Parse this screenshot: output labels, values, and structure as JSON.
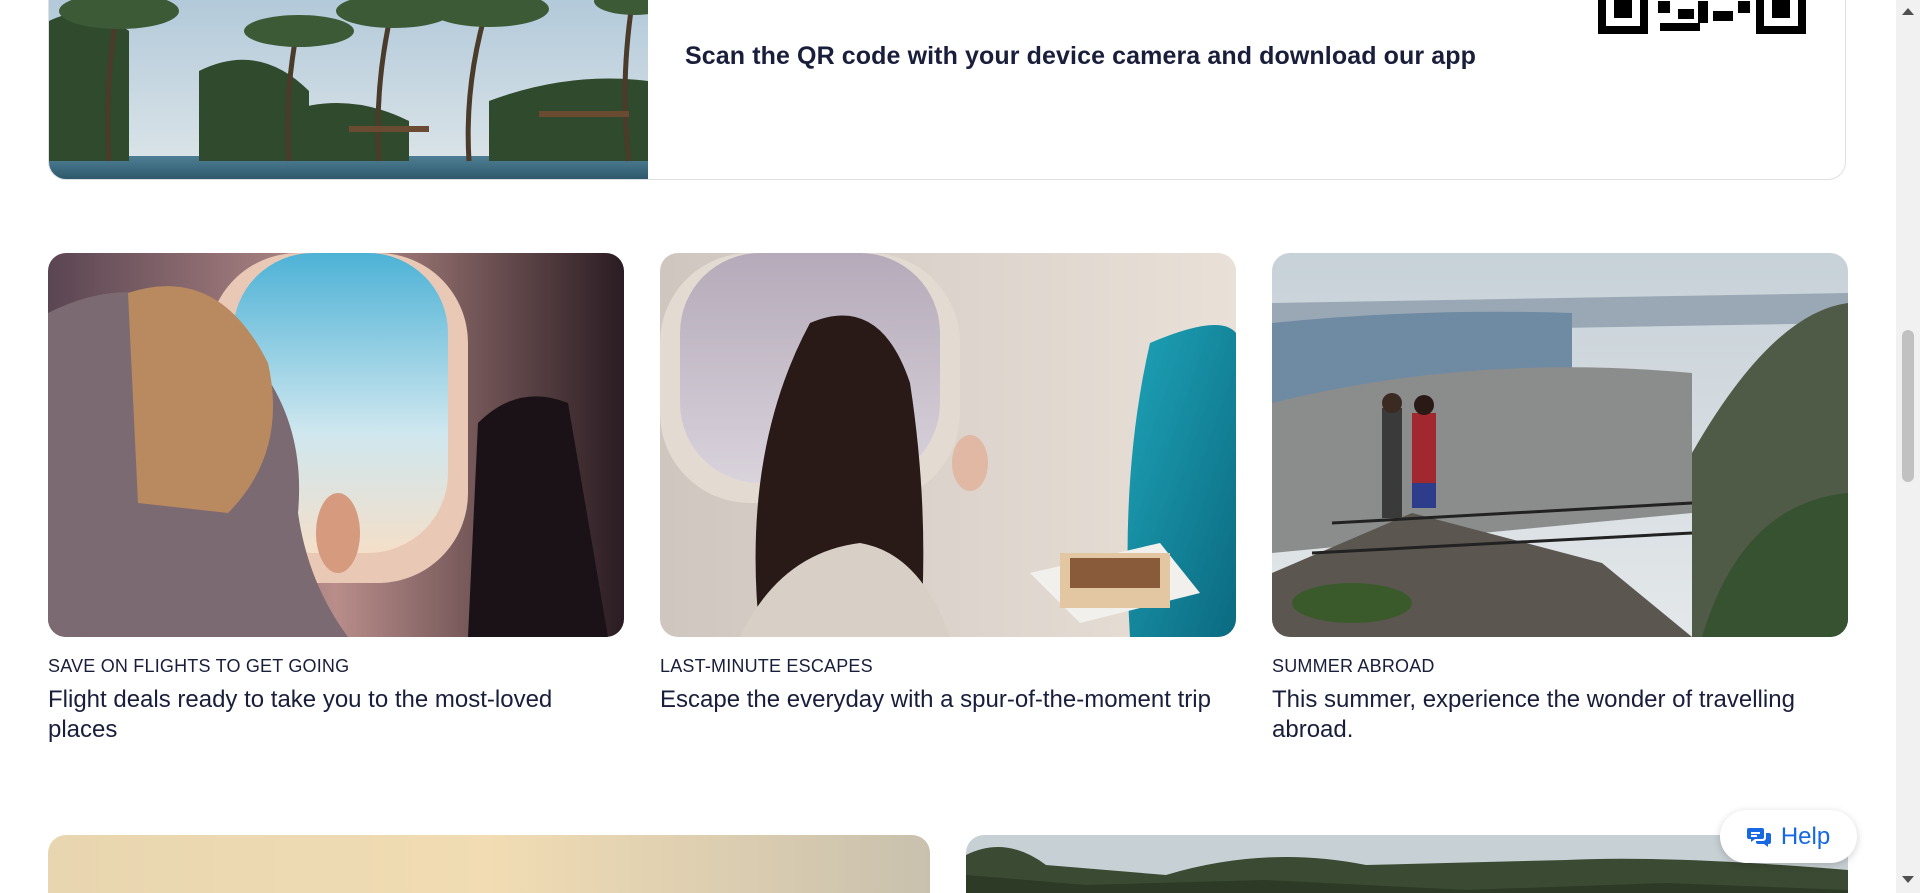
{
  "promo": {
    "text": "Scan the QR code with your device camera and download our app"
  },
  "cards": [
    {
      "kicker": "SAVE ON FLIGHTS TO GET GOING",
      "title": "Flight deals ready to take you to the most-loved places"
    },
    {
      "kicker": "LAST-MINUTE ESCAPES",
      "title": "Escape the everyday with a spur-of-the-moment trip"
    },
    {
      "kicker": "SUMMER ABROAD",
      "title": "This summer, experience the wonder of travelling abroad."
    }
  ],
  "help": {
    "label": "Help",
    "icon": "chat-bubbles-icon"
  },
  "colors": {
    "text": "#191e3b",
    "accent": "#1668e3",
    "border": "#dfe0e4"
  }
}
